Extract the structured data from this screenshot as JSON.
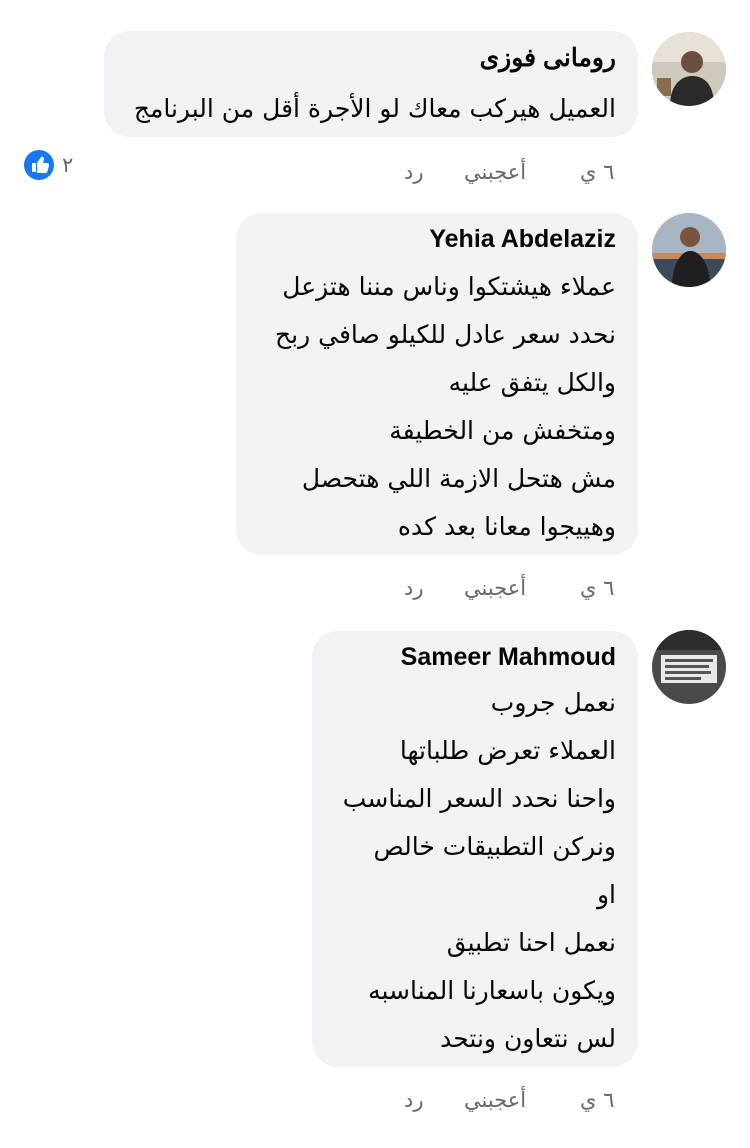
{
  "comments": [
    {
      "author": "رومانى فوزى",
      "lines": [
        "العميل هيركب معاك لو الأجرة أقل من البرنامج"
      ],
      "time": "٦ ي",
      "like_label": "أعجبني",
      "reply_label": "رد",
      "reaction_count": "٢",
      "reaction_icon": "like-icon"
    },
    {
      "author": "Yehia Abdelaziz",
      "lines": [
        "عملاء هيشتكوا وناس مننا هتزعل",
        "نحدد سعر عادل للكيلو صافي ربح",
        "والكل يتفق عليه",
        "ومتخفش من الخطيفة",
        "مش هتحل الازمة اللي هتحصل",
        "وهييجوا معانا بعد كده"
      ],
      "time": "٦ ي",
      "like_label": "أعجبني",
      "reply_label": "رد"
    },
    {
      "author": "Sameer Mahmoud",
      "lines": [
        "نعمل جروب",
        "العملاء تعرض طلباتها",
        "واحنا نحدد السعر المناسب",
        "ونركن التطبيقات خالص",
        "او",
        "نعمل احنا تطبيق",
        "ويكون باسعارنا المناسبه",
        "لس نتعاون ونتحد"
      ],
      "time": "٦ ي",
      "like_label": "أعجبني",
      "reply_label": "رد"
    }
  ],
  "colors": {
    "bubble": "#f0f2f5",
    "meta_text": "#65676b",
    "like_blue": "#1877f2"
  }
}
